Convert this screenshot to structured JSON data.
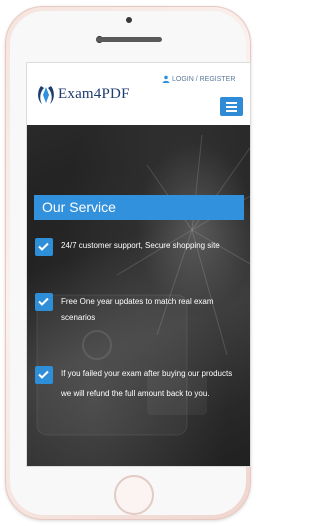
{
  "brand": {
    "name": "Exam4PDF",
    "colors": {
      "primary": "#3191dc",
      "logo_text": "#1c3d6e"
    }
  },
  "header": {
    "login_label": "LOGIN / REGISTER",
    "user_icon": "user-icon",
    "menu_icon": "hamburger-menu-icon"
  },
  "service": {
    "title": "Our Service",
    "items": [
      {
        "icon": "checkbox-checked-icon",
        "text": "24/7 customer support, Secure shopping site"
      },
      {
        "icon": "checkbox-checked-icon",
        "text": "Free One year updates to match real exam scenarios"
      },
      {
        "icon": "checkbox-checked-icon",
        "text": "If you failed your exam after buying our products we will refund the full amount back to you."
      }
    ]
  }
}
